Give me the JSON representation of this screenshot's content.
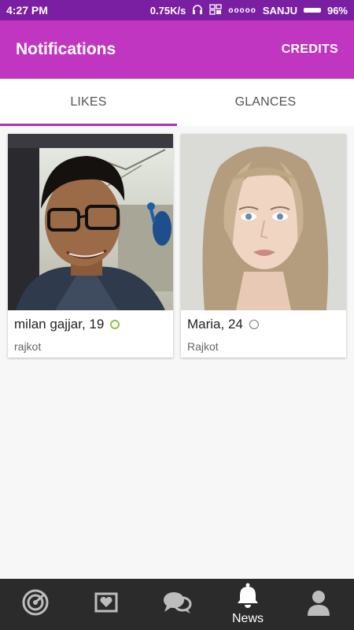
{
  "status_bar": {
    "time": "4:27 PM",
    "speed": "0.75K/s",
    "signal_dots": "ooooo",
    "carrier": "SANJU",
    "battery": "96%"
  },
  "app_bar": {
    "title": "Notifications",
    "credits_label": "CREDITS"
  },
  "tabs": [
    {
      "label": "LIKES",
      "active": true
    },
    {
      "label": "GLANCES",
      "active": false
    }
  ],
  "cards": [
    {
      "name": "milan gajjar, 19",
      "city": "rajkot",
      "online": true
    },
    {
      "name": "Maria, 24",
      "city": "Rajkot",
      "online": false
    }
  ],
  "bottom_nav": {
    "items": [
      {
        "icon": "radar-icon"
      },
      {
        "icon": "heart-frame-icon"
      },
      {
        "icon": "chat-bubbles-icon"
      },
      {
        "icon": "bell-icon",
        "label": "News",
        "active": true
      },
      {
        "icon": "person-icon"
      }
    ]
  },
  "colors": {
    "status_bar": "#7b1fa2",
    "app_bar": "#c136c0",
    "tab_indicator": "#b030b8",
    "online": "#8bc34a",
    "bottom_nav": "#2b2b2b"
  }
}
